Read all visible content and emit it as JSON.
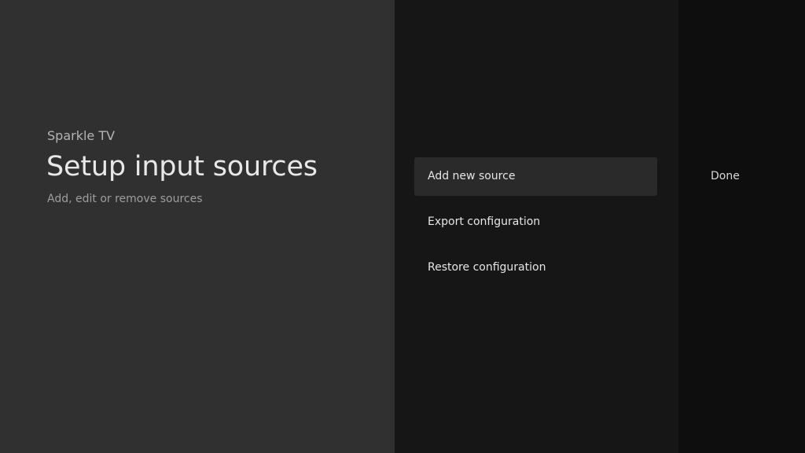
{
  "guidance": {
    "breadcrumb": "Sparkle TV",
    "title": "Setup input sources",
    "description": "Add, edit or remove sources"
  },
  "actions": [
    {
      "label": "Add new source",
      "focused": true
    },
    {
      "label": "Export configuration",
      "focused": false
    },
    {
      "label": "Restore configuration",
      "focused": false
    }
  ],
  "side": {
    "done_label": "Done"
  }
}
